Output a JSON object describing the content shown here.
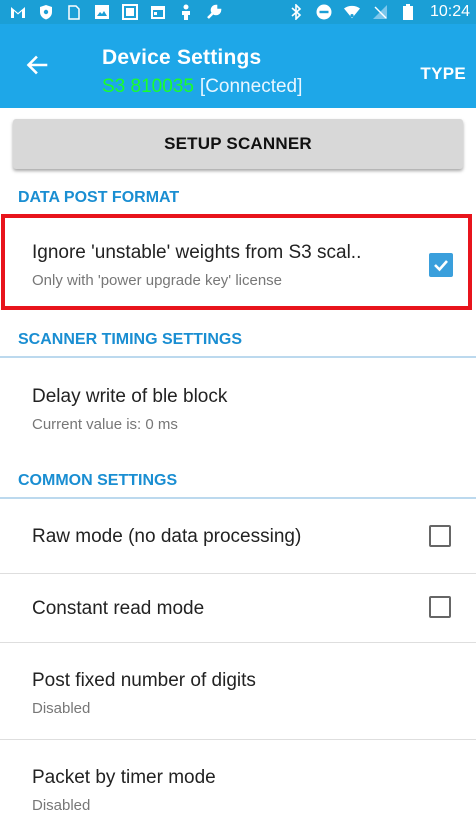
{
  "status_bar": {
    "time": "10:24",
    "left_icons": [
      "gmail-icon",
      "shield-icon",
      "sim-icon",
      "image-icon",
      "photo-icon",
      "calendar-icon",
      "person-icon",
      "wrench-icon"
    ],
    "right_icons": [
      "bluetooth-icon",
      "do-not-disturb-icon",
      "wifi-icon",
      "no-signal-icon",
      "battery-icon"
    ]
  },
  "app_bar": {
    "title": "Device Settings",
    "device": "S3 810035",
    "state": "[Connected]",
    "action": "TYPE"
  },
  "setup_button": "SETUP SCANNER",
  "sections": {
    "data_post_format": "DATA POST FORMAT",
    "scanner_timing": "SCANNER TIMING SETTINGS",
    "common": "COMMON SETTINGS"
  },
  "items": {
    "ignore_unstable": {
      "title": "Ignore 'unstable' weights from S3 scal..",
      "summary": "Only with 'power upgrade key' license",
      "checked": true
    },
    "delay_write": {
      "title": "Delay write of ble block",
      "summary": "Current value is: 0 ms"
    },
    "raw_mode": {
      "title": "Raw mode (no data processing)",
      "checked": false
    },
    "constant_read": {
      "title": "Constant read mode",
      "checked": false
    },
    "fixed_digits": {
      "title": "Post fixed number of digits",
      "summary": "Disabled"
    },
    "packet_timer": {
      "title": "Packet by timer mode",
      "summary": "Disabled"
    }
  },
  "colors": {
    "status_bar": "#1b9fd6",
    "app_bar": "#1ea7e8",
    "accent": "#1a8ed2",
    "device_name": "#19ff2a",
    "highlight": "#e8141c"
  }
}
